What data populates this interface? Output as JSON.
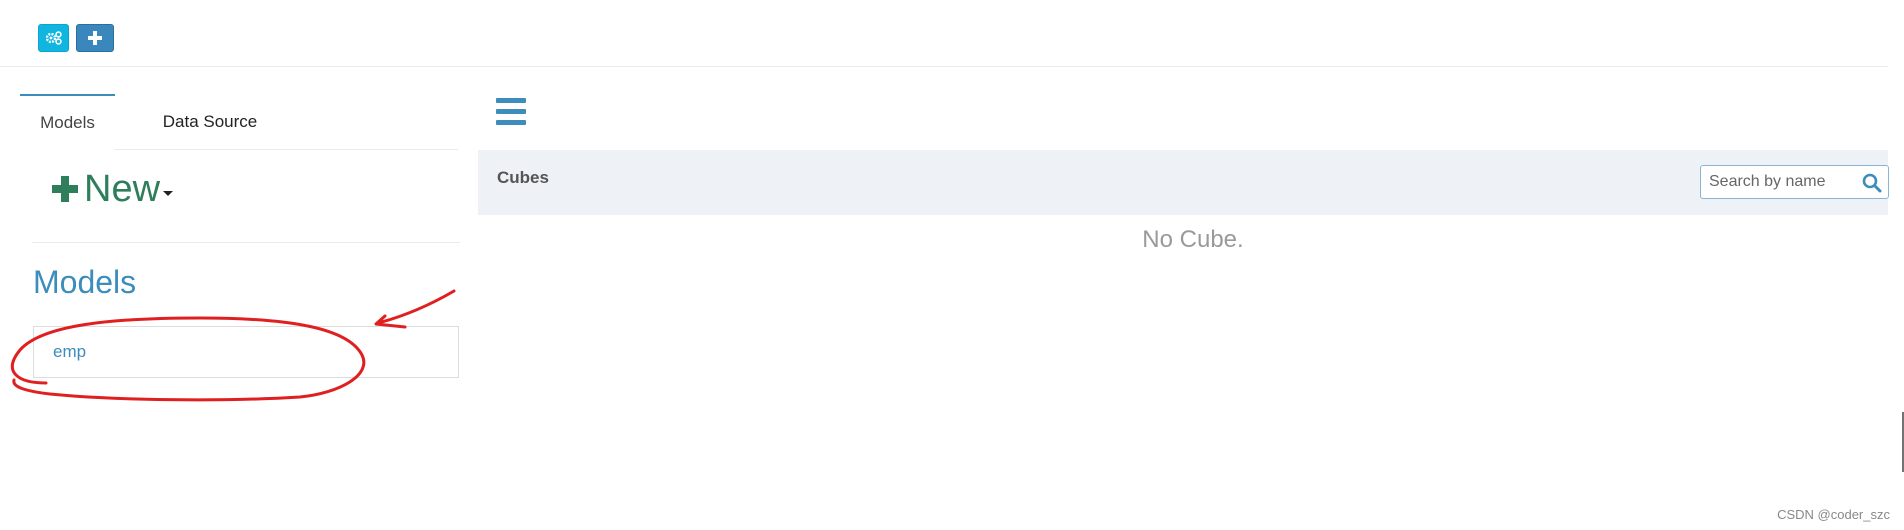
{
  "toolbar": {
    "buttons": [
      {
        "name": "settings",
        "icon": "cogs-icon"
      },
      {
        "name": "add",
        "icon": "plus-icon"
      }
    ],
    "colors": {
      "cog_button": "#10b6e0",
      "plus_button": "#3a87bd"
    }
  },
  "left_panel": {
    "tabs": [
      {
        "label": "Models",
        "active": true
      },
      {
        "label": "Data Source",
        "active": false
      }
    ],
    "new_button": {
      "label": "New",
      "icon": "plus-icon",
      "color": "#2e7d5b"
    },
    "section_title": "Models",
    "models": [
      {
        "name": "emp"
      }
    ]
  },
  "main": {
    "menu_icon": "hamburger-icon",
    "cubes_title": "Cubes",
    "search": {
      "placeholder": "Search by name",
      "value": ""
    },
    "empty_message": "No Cube."
  },
  "annotation": {
    "color": "#e02020",
    "shapes": [
      "circle-around-emp",
      "arrow-to-emp"
    ]
  },
  "watermark": "CSDN @coder_szc"
}
